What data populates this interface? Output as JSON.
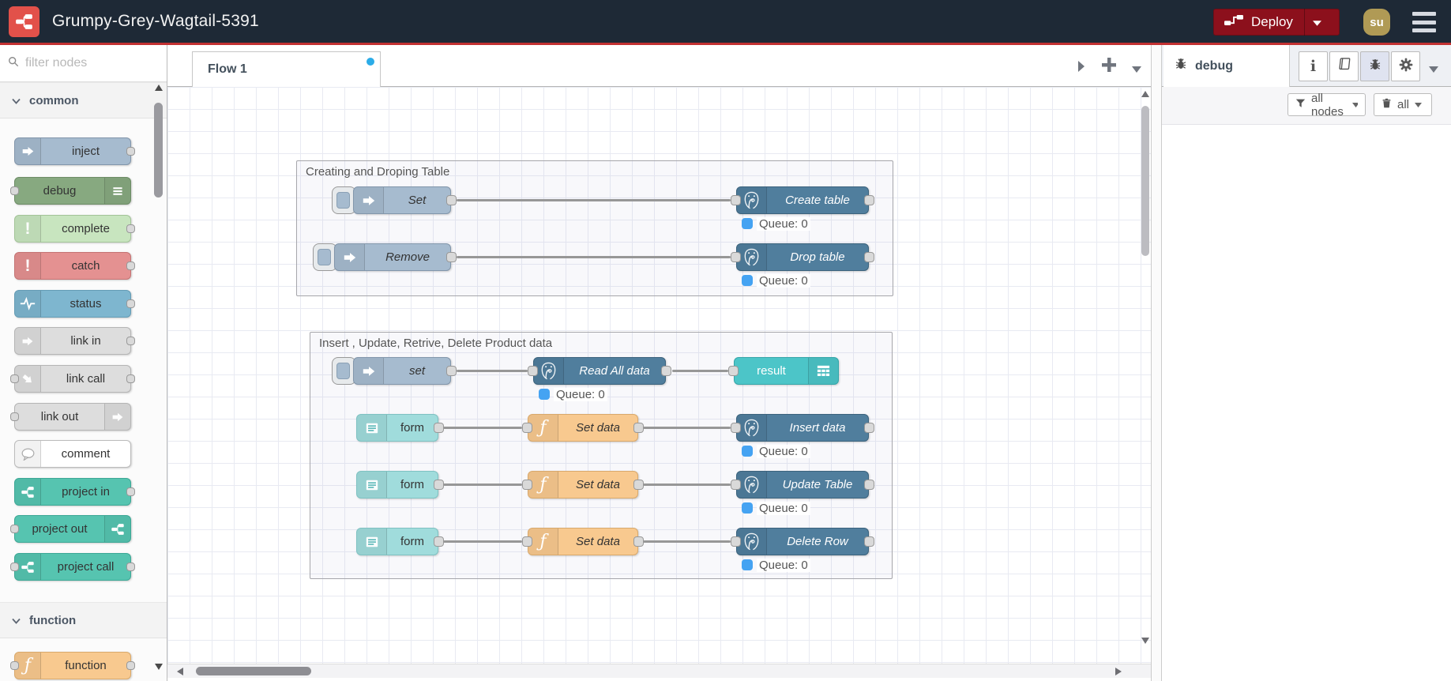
{
  "header": {
    "title": "Grumpy-Grey-Wagtail-5391",
    "deploy_label": "Deploy",
    "avatar_initials": "su"
  },
  "palette": {
    "search_placeholder": "filter nodes",
    "categories": [
      {
        "label": "common",
        "nodes": [
          {
            "label": "inject"
          },
          {
            "label": "debug"
          },
          {
            "label": "complete"
          },
          {
            "label": "catch"
          },
          {
            "label": "status"
          },
          {
            "label": "link in"
          },
          {
            "label": "link call"
          },
          {
            "label": "link out"
          },
          {
            "label": "comment"
          },
          {
            "label": "project in"
          },
          {
            "label": "project out"
          },
          {
            "label": "project call"
          }
        ]
      },
      {
        "label": "function",
        "nodes": [
          {
            "label": "function"
          }
        ]
      }
    ]
  },
  "workspace": {
    "tab_label": "Flow 1"
  },
  "canvas": {
    "groups": [
      {
        "title": "Creating and Droping Table",
        "set_label": "Set",
        "create_label": "Create table",
        "remove_label": "Remove",
        "drop_label": "Drop table",
        "queue1": "Queue: 0",
        "queue2": "Queue: 0"
      },
      {
        "title": "Insert , Update, Retrive, Delete Product data",
        "set_label": "set",
        "read_label": "Read All data",
        "result_label": "result",
        "form_label": "form",
        "setdata_label": "Set data",
        "insert_label": "Insert data",
        "update_label": "Update Table",
        "delete_label": "Delete Row",
        "queue1": "Queue: 0",
        "queue2": "Queue: 0",
        "queue3": "Queue: 0",
        "queue4": "Queue: 0"
      }
    ]
  },
  "sidebar": {
    "tab_label": "debug",
    "filter_button": "all nodes",
    "clear_button": "all"
  },
  "colors": {
    "header_bg": "#1e2936",
    "header_accent_line": "#c23132",
    "deploy_red": "#8C101C",
    "logo_red": "#e2514a",
    "avatar_gold": "#b09a55",
    "node_inject": "#a6bbcf",
    "node_debug": "#87a980",
    "node_complete": "#c8e5bf",
    "node_catch": "#e49191",
    "node_status": "#7eb6cf",
    "node_link": "#dddddd",
    "node_comment": "#ffffff",
    "node_project": "#56c4b0",
    "node_function": "#f8c98f",
    "node_postgres": "#507e9d",
    "node_form": "#a0dcdc",
    "node_result": "#4cc5c8",
    "queue_badge_blue": "#45a3f2",
    "unsaved_dot_blue": "#2bace8"
  }
}
